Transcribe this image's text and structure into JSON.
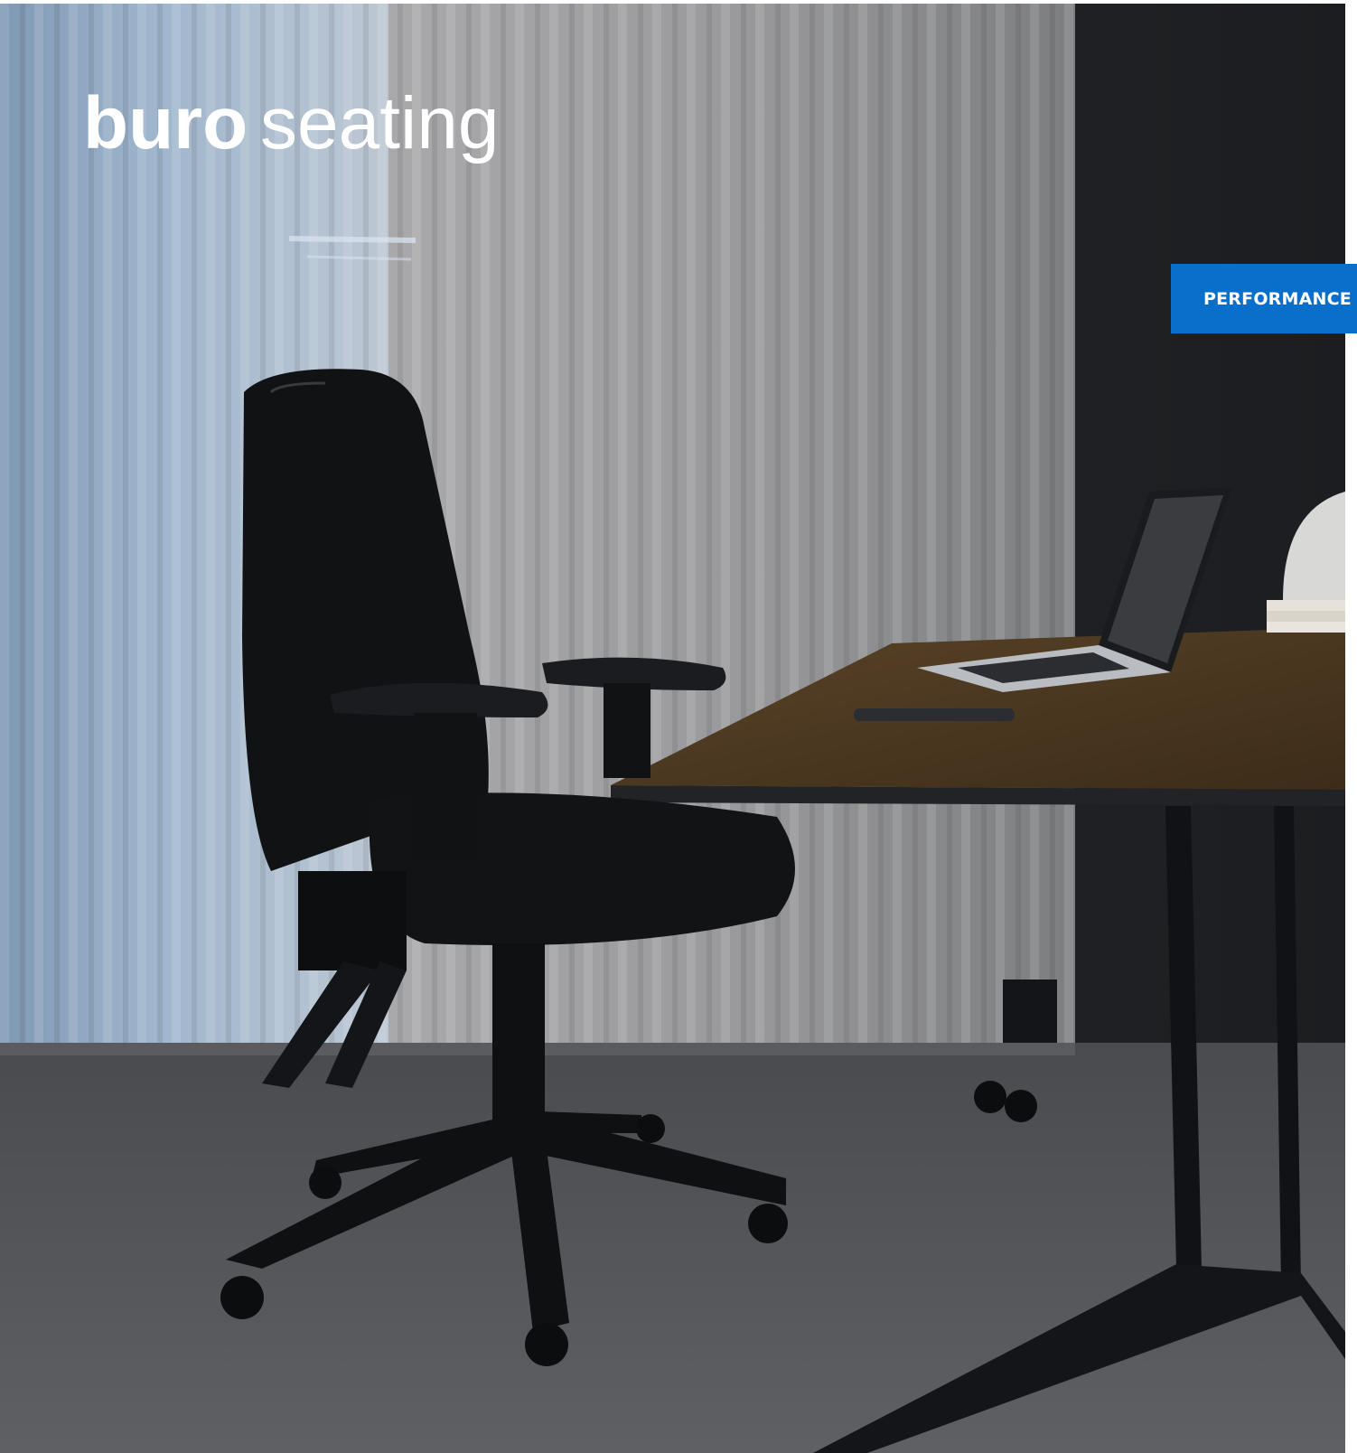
{
  "brand": {
    "logo_text_bold": "buro",
    "logo_text_light": "seating"
  },
  "category_tab": {
    "label": "PERFORMANCE",
    "color": "#0a6fcb"
  },
  "hero_image": {
    "alt": "Black leather ergonomic office chair beside a wooden desk with an open laptop and a phone, in front of sheer curtains"
  }
}
